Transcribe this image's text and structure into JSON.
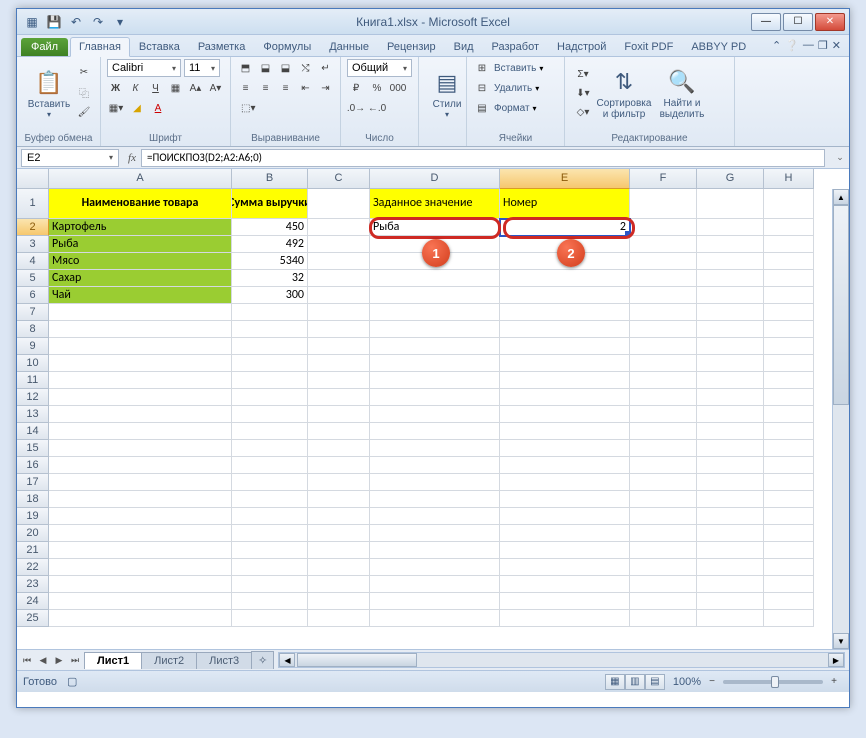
{
  "title": "Книга1.xlsx - Microsoft Excel",
  "qat": {
    "save": "💾",
    "undo": "↶",
    "redo": "↷"
  },
  "tabs": {
    "file": "Файл",
    "items": [
      "Главная",
      "Вставка",
      "Разметка",
      "Формулы",
      "Данные",
      "Рецензир",
      "Вид",
      "Разработ",
      "Надстрой",
      "Foxit PDF",
      "ABBYY PD"
    ],
    "active": 0
  },
  "ribbon": {
    "clipboard": {
      "paste": "Вставить",
      "label": "Буфер обмена"
    },
    "font": {
      "name": "Calibri",
      "size": "11",
      "label": "Шрифт"
    },
    "align": {
      "label": "Выравнивание"
    },
    "number": {
      "format": "Общий",
      "label": "Число"
    },
    "styles": {
      "btn": "Стили",
      "label": ""
    },
    "cells": {
      "insert": "Вставить",
      "delete": "Удалить",
      "format": "Формат",
      "label": "Ячейки"
    },
    "editing": {
      "sort": "Сортировка и фильтр",
      "find": "Найти и выделить",
      "label": "Редактирование"
    }
  },
  "namebox": "E2",
  "formula": "=ПОИСКПОЗ(D2;A2:A6;0)",
  "columns": [
    "A",
    "B",
    "C",
    "D",
    "E",
    "F",
    "G",
    "H"
  ],
  "headers": {
    "A1": "Наименование товара",
    "B1": "Сумма выручки",
    "D1": "Заданное значение",
    "E1": "Номер"
  },
  "data_rows": [
    {
      "name": "Картофель",
      "sum": "450"
    },
    {
      "name": "Рыба",
      "sum": "492"
    },
    {
      "name": "Мясо",
      "sum": "5340"
    },
    {
      "name": "Сахар",
      "sum": "32"
    },
    {
      "name": "Чай",
      "sum": "300"
    }
  ],
  "lookup": {
    "D2": "Рыба",
    "E2": "2"
  },
  "callouts": {
    "b1": "1",
    "b2": "2"
  },
  "sheets": [
    "Лист1",
    "Лист2",
    "Лист3"
  ],
  "status": "Готово",
  "zoom": "100%"
}
